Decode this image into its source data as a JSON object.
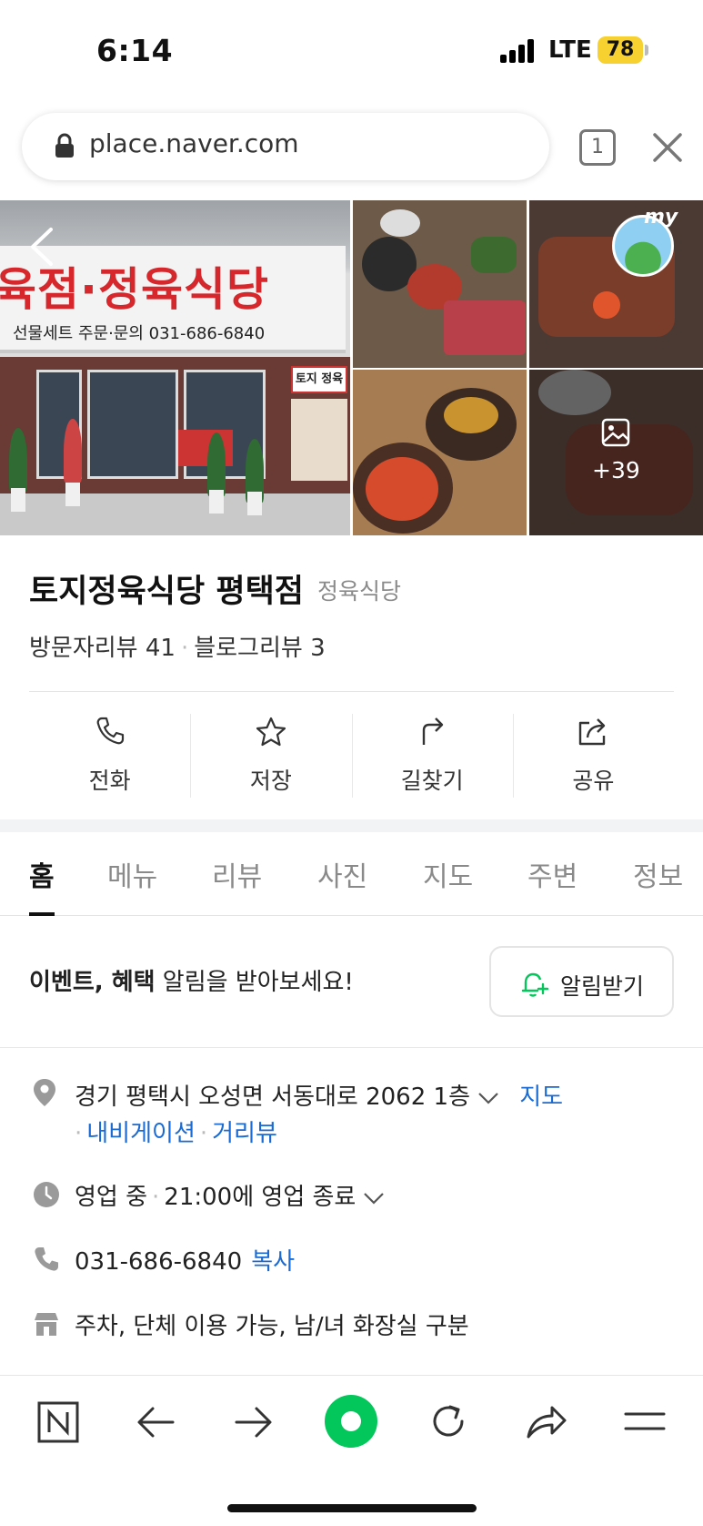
{
  "status_bar": {
    "time": "6:14",
    "network": "LTE",
    "battery": "78"
  },
  "browser": {
    "url": "place.naver.com",
    "tab_count": "1"
  },
  "gallery": {
    "sign_text": "육점·정육식당",
    "sign_subtext": "선물세트   주문·문의 031-686-6840",
    "store_sign": "토지 정육",
    "avatar_label": "my",
    "more_count": "+39"
  },
  "place": {
    "name": "토지정육식당 평택점",
    "category": "정육식당",
    "visitor_reviews": "방문자리뷰 41",
    "blog_reviews": "블로그리뷰 3"
  },
  "actions": [
    {
      "label": "전화",
      "icon": "phone-icon"
    },
    {
      "label": "저장",
      "icon": "star-icon"
    },
    {
      "label": "길찾기",
      "icon": "directions-icon"
    },
    {
      "label": "공유",
      "icon": "share-icon"
    }
  ],
  "tabs": [
    "홈",
    "메뉴",
    "리뷰",
    "사진",
    "지도",
    "주변",
    "정보"
  ],
  "active_tab": "홈",
  "notice": {
    "bold": "이벤트, 혜택",
    "rest": " 알림을 받아보세요!",
    "button": "알림받기"
  },
  "info": {
    "address": "경기 평택시 오성면 서동대로 2062 1층",
    "map_link": "지도",
    "navigation_link": "내비게이션",
    "street_view_link": "거리뷰",
    "hours_status": "영업 중",
    "hours_detail": "21:00에 영업 종료",
    "phone": "031-686-6840",
    "copy_link": "복사",
    "amenities": "주차, 단체 이용 가능, 남/녀 화장실 구분"
  },
  "colors": {
    "accent_green": "#03c75a",
    "link_blue": "#1a6ad2",
    "sign_red": "#d6282c",
    "battery_yellow": "#f6d130"
  }
}
